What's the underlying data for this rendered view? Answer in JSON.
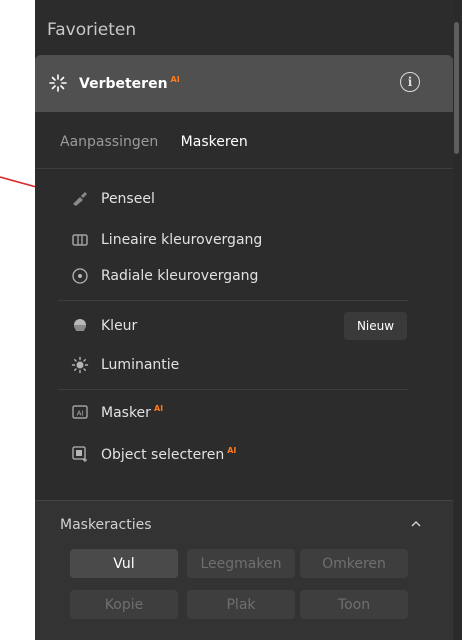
{
  "header": {
    "title": "Favorieten"
  },
  "enhance": {
    "label": "Verbeteren",
    "ai": "AI",
    "info_icon": "info-icon"
  },
  "tabs": [
    {
      "label": "Aanpassingen",
      "active": false
    },
    {
      "label": "Maskeren",
      "active": true
    }
  ],
  "mask_tools": {
    "group1": [
      {
        "label": "Penseel",
        "icon": "brush-icon"
      },
      {
        "label": "Lineaire kleurovergang",
        "icon": "linear-gradient-icon"
      },
      {
        "label": "Radiale kleurovergang",
        "icon": "radial-gradient-icon"
      }
    ],
    "group2": [
      {
        "label": "Kleur",
        "icon": "color-icon",
        "badge": "Nieuw"
      },
      {
        "label": "Luminantie",
        "icon": "luminance-icon"
      }
    ],
    "group3": [
      {
        "label": "Masker",
        "icon": "ai-mask-icon",
        "ai": "AI"
      },
      {
        "label": "Object selecteren",
        "icon": "object-select-icon",
        "ai": "AI"
      }
    ]
  },
  "mask_actions": {
    "title": "Maskeracties",
    "buttons": [
      {
        "label": "Vul",
        "enabled": true
      },
      {
        "label": "Leegmaken",
        "enabled": false
      },
      {
        "label": "Omkeren",
        "enabled": false
      },
      {
        "label": "Kopie",
        "enabled": false
      },
      {
        "label": "Plak",
        "enabled": false
      },
      {
        "label": "Toon",
        "enabled": false
      }
    ]
  },
  "annotation": {
    "arrow_color": "#d62b2b"
  },
  "colors": {
    "accent_ai": "#ff7a1a",
    "panel_bg": "#2c2c2c",
    "header_bg": "#505050"
  }
}
